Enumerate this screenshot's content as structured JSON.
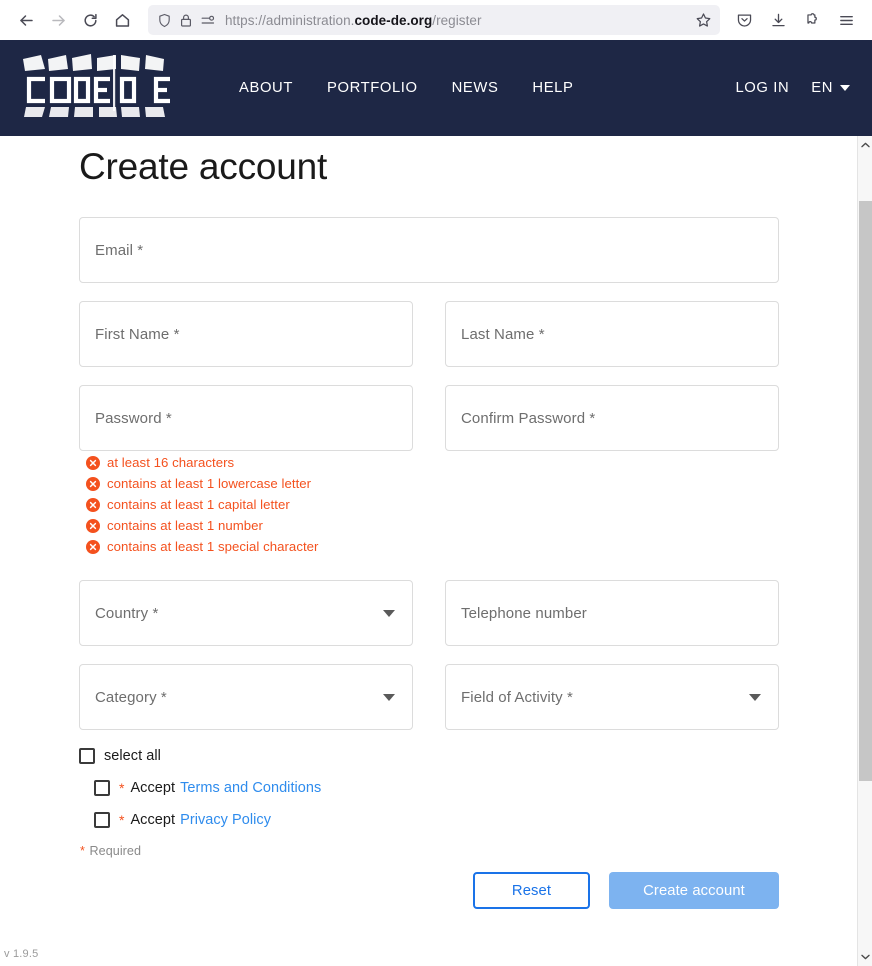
{
  "browser": {
    "back_label": "Back",
    "forward_label": "Forward",
    "reload_label": "Reload",
    "home_label": "Home",
    "url_prefix": "https://administration.",
    "url_domain": "code-de.org",
    "url_suffix": "/register",
    "bookmark_label": "Bookmark this page",
    "pocket_label": "Save to Pocket",
    "downloads_label": "Downloads",
    "extensions_label": "Extensions",
    "menu_label": "Application menu",
    "shield_label": "Tracking protection",
    "lock_label": "Connection secure",
    "permissions_label": "Site permissions"
  },
  "site_header": {
    "logo_text_left": "CODE",
    "logo_text_right": "DE",
    "nav": [
      {
        "label": "ABOUT"
      },
      {
        "label": "PORTFOLIO"
      },
      {
        "label": "NEWS"
      },
      {
        "label": "HELP"
      }
    ],
    "login_label": "LOG IN",
    "language": "EN",
    "background_color": "#1e2745"
  },
  "page": {
    "title": "Create account",
    "version": "v 1.9.5"
  },
  "form": {
    "fields": {
      "email": {
        "placeholder": "Email *"
      },
      "first_name": {
        "placeholder": "First Name *"
      },
      "last_name": {
        "placeholder": "Last Name *"
      },
      "password": {
        "placeholder": "Password *"
      },
      "confirm_password": {
        "placeholder": "Confirm Password *"
      },
      "country": {
        "placeholder": "Country *"
      },
      "telephone": {
        "placeholder": "Telephone number"
      },
      "category": {
        "placeholder": "Category *"
      },
      "field_of_activity": {
        "placeholder": "Field of Activity *"
      }
    },
    "password_rules": [
      {
        "text": "at least 16 characters",
        "state": "invalid"
      },
      {
        "text": "contains at least 1 lowercase letter",
        "state": "invalid"
      },
      {
        "text": "contains at least 1 capital letter",
        "state": "invalid"
      },
      {
        "text": "contains at least 1 number",
        "state": "invalid"
      },
      {
        "text": "contains at least 1 special character",
        "state": "invalid"
      }
    ],
    "password_rule_color": "#f4511e",
    "checkboxes": {
      "select_all": "select all",
      "accept_label": "Accept",
      "terms_link": "Terms and Conditions",
      "privacy_link": "Privacy Policy",
      "required_star": "*",
      "required_note": "Required",
      "link_color": "#2f8ced"
    },
    "buttons": {
      "reset": "Reset",
      "create": "Create account",
      "reset_color": "#1a73e8",
      "create_color": "#7db3f0"
    }
  }
}
